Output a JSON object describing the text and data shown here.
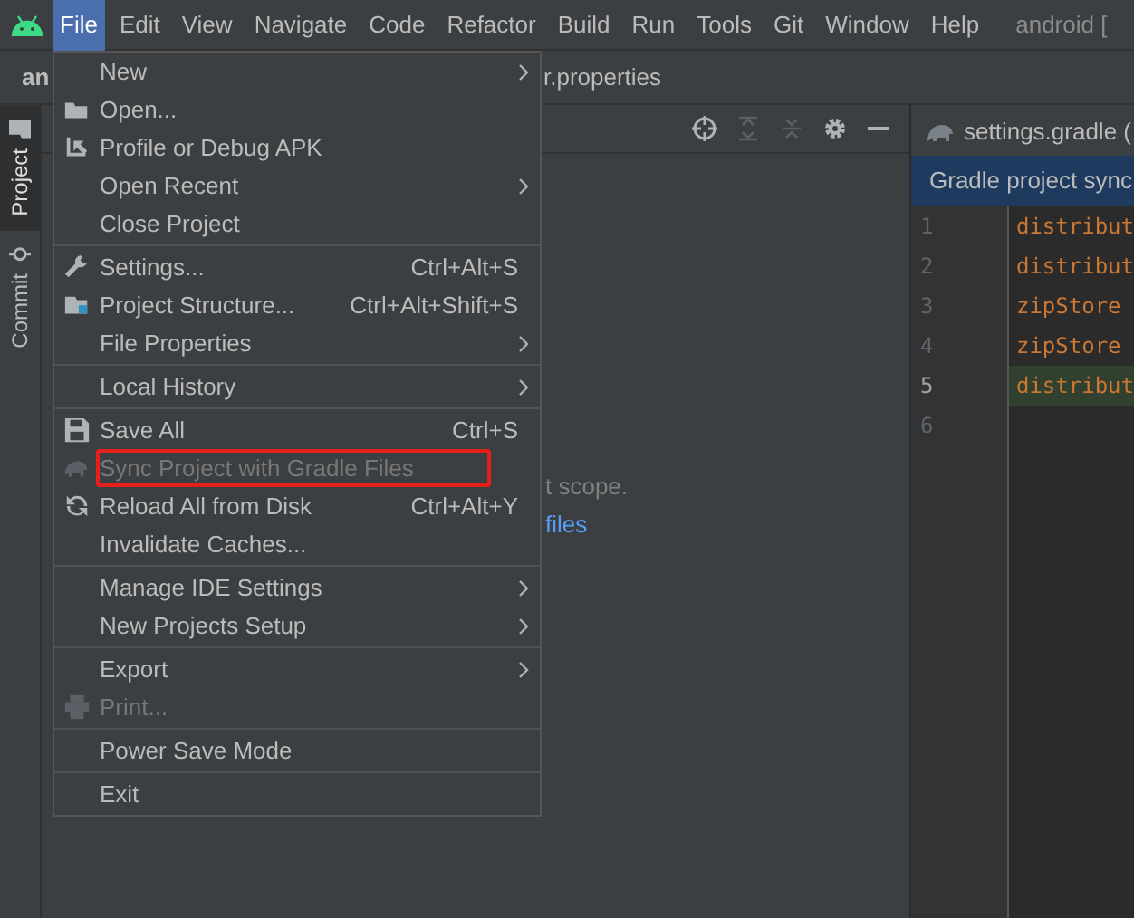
{
  "menu_bar": {
    "items": [
      {
        "label": "File",
        "selected": true
      },
      {
        "label": "Edit",
        "selected": false
      },
      {
        "label": "View",
        "selected": false
      },
      {
        "label": "Navigate",
        "selected": false
      },
      {
        "label": "Code",
        "selected": false
      },
      {
        "label": "Refactor",
        "selected": false
      },
      {
        "label": "Build",
        "selected": false
      },
      {
        "label": "Run",
        "selected": false
      },
      {
        "label": "Tools",
        "selected": false
      },
      {
        "label": "Git",
        "selected": false
      },
      {
        "label": "Window",
        "selected": false
      },
      {
        "label": "Help",
        "selected": false
      }
    ],
    "project_title": "android ["
  },
  "tab_row": {
    "left_tab": "an",
    "right_tab": "r.properties"
  },
  "tool_strip": [
    {
      "label": "Project",
      "selected": true
    },
    {
      "label": "Commit",
      "selected": false
    }
  ],
  "project_panel": {
    "hint": "t scope.",
    "link": "files"
  },
  "editor": {
    "tab": "settings.gradle (",
    "banner": "Gradle project sync",
    "lines": [
      {
        "number": "1",
        "code": "distribut",
        "current": false
      },
      {
        "number": "2",
        "code": "distribut",
        "current": false
      },
      {
        "number": "3",
        "code": "zipStore",
        "current": false
      },
      {
        "number": "4",
        "code": "zipStore",
        "current": false
      },
      {
        "number": "5",
        "code": "distribut",
        "current": true
      },
      {
        "number": "6",
        "current": false
      }
    ]
  },
  "file_menu": {
    "items": [
      {
        "kind": "item",
        "label": "New",
        "submenu": true,
        "disabled": false,
        "highlighted": false
      },
      {
        "kind": "item",
        "label": "Open...",
        "submenu": false,
        "disabled": false,
        "highlighted": false
      },
      {
        "kind": "item",
        "label": "Profile or Debug APK",
        "submenu": false,
        "disabled": false,
        "highlighted": false
      },
      {
        "kind": "item",
        "label": "Open Recent",
        "submenu": true,
        "disabled": false,
        "highlighted": false
      },
      {
        "kind": "item",
        "label": "Close Project",
        "submenu": false,
        "disabled": false,
        "highlighted": false
      },
      {
        "kind": "separator"
      },
      {
        "kind": "item",
        "label": "Settings...",
        "shortcut": "Ctrl+Alt+S",
        "submenu": false,
        "disabled": false,
        "highlighted": false
      },
      {
        "kind": "item",
        "label": "Project Structure...",
        "shortcut": "Ctrl+Alt+Shift+S",
        "submenu": false,
        "disabled": false,
        "highlighted": false
      },
      {
        "kind": "item",
        "label": "File Properties",
        "submenu": true,
        "disabled": false,
        "highlighted": false
      },
      {
        "kind": "separator"
      },
      {
        "kind": "item",
        "label": "Local History",
        "submenu": true,
        "disabled": false,
        "highlighted": false
      },
      {
        "kind": "separator"
      },
      {
        "kind": "item",
        "label": "Save All",
        "shortcut": "Ctrl+S",
        "submenu": false,
        "disabled": false,
        "highlighted": false
      },
      {
        "kind": "item",
        "label": "Sync Project with Gradle Files",
        "submenu": false,
        "disabled": true,
        "highlighted": true
      },
      {
        "kind": "item",
        "label": "Reload All from Disk",
        "shortcut": "Ctrl+Alt+Y",
        "submenu": false,
        "disabled": false,
        "highlighted": false
      },
      {
        "kind": "item",
        "label": "Invalidate Caches...",
        "submenu": false,
        "disabled": false,
        "highlighted": false
      },
      {
        "kind": "separator"
      },
      {
        "kind": "item",
        "label": "Manage IDE Settings",
        "submenu": true,
        "disabled": false,
        "highlighted": false
      },
      {
        "kind": "item",
        "label": "New Projects Setup",
        "submenu": true,
        "disabled": false,
        "highlighted": false
      },
      {
        "kind": "separator"
      },
      {
        "kind": "item",
        "label": "Export",
        "submenu": true,
        "disabled": false,
        "highlighted": false
      },
      {
        "kind": "item",
        "label": "Print...",
        "submenu": false,
        "disabled": true,
        "highlighted": false
      },
      {
        "kind": "separator"
      },
      {
        "kind": "item",
        "label": "Power Save Mode",
        "submenu": false,
        "disabled": false,
        "highlighted": false
      },
      {
        "kind": "separator"
      },
      {
        "kind": "item",
        "label": "Exit",
        "submenu": false,
        "disabled": false,
        "highlighted": false
      }
    ]
  }
}
